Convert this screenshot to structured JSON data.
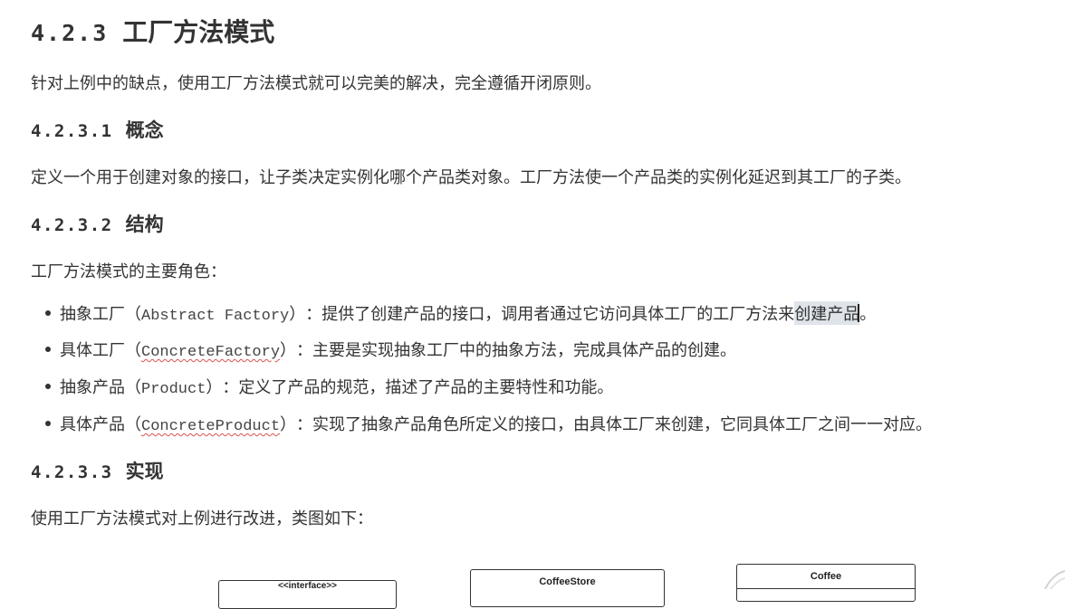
{
  "heading": {
    "number": "4.2.3",
    "title": "工厂方法模式"
  },
  "intro": "针对上例中的缺点，使用工厂方法模式就可以完美的解决，完全遵循开闭原则。",
  "section_concept": {
    "number": "4.2.3.1",
    "title": "概念"
  },
  "concept_text": "定义一个用于创建对象的接口，让子类决定实例化哪个产品类对象。工厂方法使一个产品类的实例化延迟到其工厂的子类。",
  "section_structure": {
    "number": "4.2.3.2",
    "title": "结构"
  },
  "roles_intro": "工厂方法模式的主要角色：",
  "roles": [
    {
      "name": "抽象工厂",
      "code": "Abstract Factory",
      "desc_a": "：提供了创建产品的接口，调用者通过它访问具体工厂的工厂方法来",
      "desc_sel": "创建产品",
      "desc_end": "。"
    },
    {
      "name": "具体工厂",
      "code": "ConcreteFactory",
      "desc": "：主要是实现抽象工厂中的抽象方法，完成具体产品的创建。"
    },
    {
      "name": "抽象产品",
      "code": "Product",
      "desc": "：定义了产品的规范，描述了产品的主要特性和功能。"
    },
    {
      "name": "具体产品",
      "code": "ConcreteProduct",
      "desc": "：实现了抽象产品角色所定义的接口，由具体工厂来创建，它同具体工厂之间一一对应。"
    }
  ],
  "section_impl": {
    "number": "4.2.3.3",
    "title": "实现"
  },
  "impl_text": "使用工厂方法模式对上例进行改进，类图如下：",
  "diagram": {
    "interface_label": "<<interface>>",
    "coffee_store": "CoffeeStore",
    "coffee": "Coffee"
  }
}
